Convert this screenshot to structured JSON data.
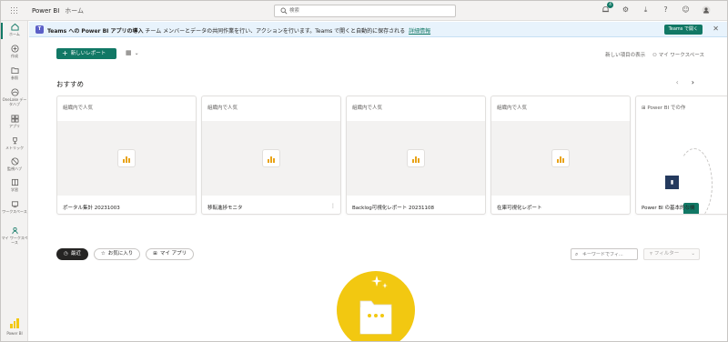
{
  "app": {
    "title": "Power BI",
    "workspace": "ホーム"
  },
  "search": {
    "placeholder": "検索"
  },
  "topbar": {
    "notification_count": "4"
  },
  "leftnav": {
    "items": [
      {
        "label": "ホーム",
        "icon": "home-icon"
      },
      {
        "label": "作成",
        "icon": "plus-circle-icon"
      },
      {
        "label": "参照",
        "icon": "folder-icon"
      },
      {
        "label": "OneLake データハブ",
        "icon": "onelake-icon"
      },
      {
        "label": "アプリ",
        "icon": "apps-icon"
      },
      {
        "label": "メトリック",
        "icon": "trophy-icon"
      },
      {
        "label": "監視ハブ",
        "icon": "monitor-icon"
      },
      {
        "label": "学習",
        "icon": "book-icon"
      },
      {
        "label": "ワークスペース",
        "icon": "workspaces-icon"
      },
      {
        "label": "マイ ワークスペース",
        "icon": "person-icon"
      }
    ],
    "footer_label": "Power BI"
  },
  "banner": {
    "bold": "Teams への Power BI アプリの導入",
    "text": "チーム メンバーとデータの共同作業を行い、アクションを行います。Teams で開くと自動的に保存される",
    "link": "詳細情報",
    "button": "Teams で開く"
  },
  "actions": {
    "new_report": "新しいレポート",
    "right_text": "新しい項目の表示",
    "person_text": "マイ ワークスペース"
  },
  "recommended": {
    "title": "おすすめ",
    "cards": [
      {
        "head": "組織内で人気",
        "name": "ポータル集計 20231003"
      },
      {
        "head": "組織内で人気",
        "name": "移転進捗モニタ"
      },
      {
        "head": "組織内で人気",
        "name": "Backlog可視化レポート 20231108"
      },
      {
        "head": "組織内で人気",
        "name": "在庫可視化レポート"
      },
      {
        "head": "Power BI での作",
        "name": "Power BI の基本的な機"
      }
    ]
  },
  "filters": {
    "tabs": [
      "最近",
      "お気に入り",
      "マイ アプリ"
    ],
    "search_placeholder": "キーワードでフィ...",
    "filter_label": "フィルター"
  },
  "colors": {
    "accent": "#117865",
    "banner_bg": "#e8f3fc",
    "illustration_yellow": "#f2c811"
  }
}
